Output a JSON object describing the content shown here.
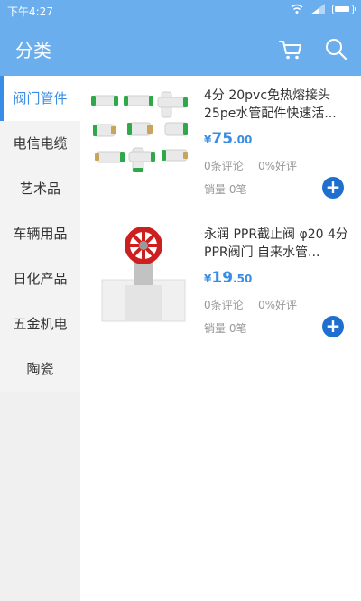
{
  "status_bar": {
    "time": "下午4:27"
  },
  "header": {
    "title": "分类",
    "cart_icon": "cart-icon",
    "search_icon": "search-icon"
  },
  "colors": {
    "primary": "#6aaeee",
    "accent": "#3a8de6",
    "add_button": "#1f6fcf"
  },
  "sidebar": {
    "items": [
      {
        "label": "阀门管件",
        "active": true
      },
      {
        "label": "电信电缆",
        "active": false
      },
      {
        "label": "艺术品",
        "active": false
      },
      {
        "label": "车辆用品",
        "active": false
      },
      {
        "label": "日化产品",
        "active": false
      },
      {
        "label": "五金机电",
        "active": false
      },
      {
        "label": "陶瓷",
        "active": false
      }
    ]
  },
  "products": [
    {
      "name": "4分 20pvc免热熔接头25pe水管配件快速活...",
      "price_currency": "¥",
      "price_int": "75",
      "price_dec": ".00",
      "reviews": "0条评论",
      "positive_rate": "0%好评",
      "sales": "销量 0笔",
      "add_icon": "plus-icon"
    },
    {
      "name": "永润 PPR截止阀 φ20 4分 PPR阀门 自来水管...",
      "price_currency": "¥",
      "price_int": "19",
      "price_dec": ".50",
      "reviews": "0条评论",
      "positive_rate": "0%好评",
      "sales": "销量 0笔",
      "add_icon": "plus-icon"
    }
  ]
}
